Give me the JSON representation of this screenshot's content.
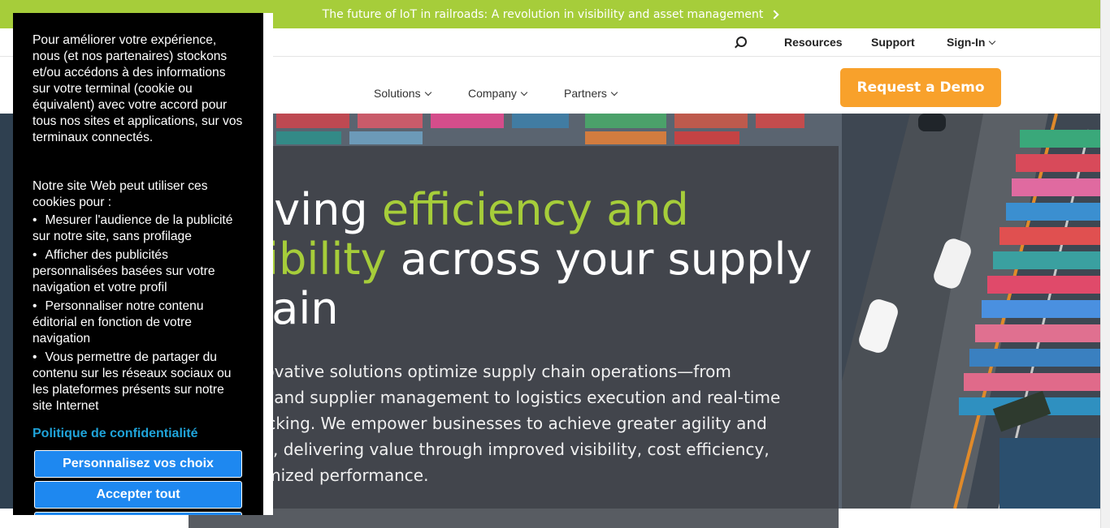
{
  "announcement": {
    "text": "The future of IoT in railroads: A revolution in visibility and asset management"
  },
  "utility_nav": {
    "resources": "Resources",
    "support": "Support",
    "signin": "Sign-In"
  },
  "main_nav": {
    "solutions": "Solutions",
    "company": "Company",
    "partners": "Partners",
    "demo": "Request a Demo"
  },
  "hero": {
    "headline_start": "riving ",
    "headline_highlight1": "efficiency and",
    "headline_highlight2": "sibility",
    "headline_rest1": " across your supply",
    "headline_rest2": "hain",
    "body": "nnovative solutions optimize supply chain operations—from\ning and supplier management to logistics execution and real-time\ntracking. We empower businesses to achieve greater agility and\nnce, delivering value through improved visibility, cost efficiency,\nptimized performance."
  },
  "cookie": {
    "intro": "Pour améliorer votre expérience, nous (et nos partenaires) stockons et/ou accédons à des informations sur votre terminal (cookie ou équivalent) avec votre accord pour tous nos sites et applications, sur vos terminaux connectés.",
    "intro2": "Notre site Web peut utiliser ces cookies pour :",
    "items": [
      "Mesurer l'audience de la publicité sur notre site, sans profilage",
      "Afficher des publicités personnalisées basées sur votre navigation et votre profil",
      "Personnaliser notre contenu éditorial en fonction de votre navigation",
      "Vous permettre de partager du contenu sur les réseaux sociaux ou les plateformes présents sur notre site Internet"
    ],
    "policy": "Politique de confidentialité",
    "customize": "Personnalisez vos choix",
    "accept": "Accepter tout"
  },
  "colors": {
    "accent_green": "#a6cd3a",
    "demo_orange": "#f8a12b",
    "cookie_button": "#1e88f0",
    "policy_link": "#1fa3d9"
  }
}
